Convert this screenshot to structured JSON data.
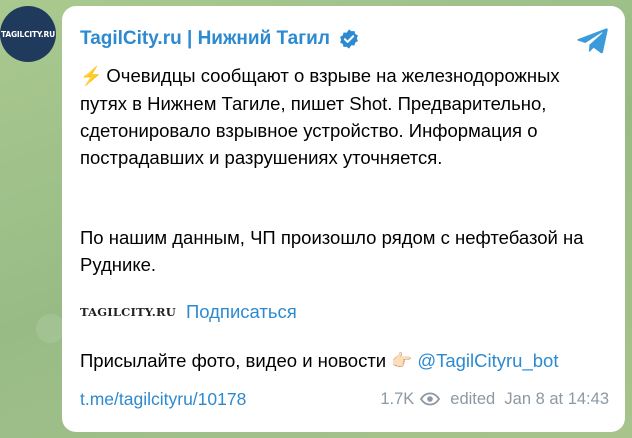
{
  "channel": {
    "avatar_text": "TAGILCITY.RU",
    "name": "TagilCity.ru | Нижний Тагил",
    "verified_icon": "verified-badge-icon",
    "share_icon": "telegram-plane-icon"
  },
  "message": {
    "bolt_icon": "⚡",
    "paragraph1": "Очевидцы сообщают о взрыве на железнодорожных путях в Нижнем Тагиле, пишет Shot. Предварительно, сдетонировало взрывное устройство. Информация о пострадавших и разрушениях уточняется.",
    "paragraph2": "По нашим данным, ЧП произошло рядом с нефтебазой на Руднике.",
    "logo_text": "TAGILCITY.RU",
    "subscribe_label": "Подписаться",
    "send_text": "Присылайте фото, видео и новости",
    "hand_icon": "👉🏻",
    "bot_link": "@TagilCityru_bot"
  },
  "footer": {
    "post_link": "t.me/tagilcityru/10178",
    "views": "1.7K",
    "eye_icon": "eye-icon",
    "edited": "edited  Jan 8 at 14:43"
  },
  "colors": {
    "accent": "#2d8ad0",
    "background": "#9fc08c",
    "meta": "#8d98a2"
  }
}
